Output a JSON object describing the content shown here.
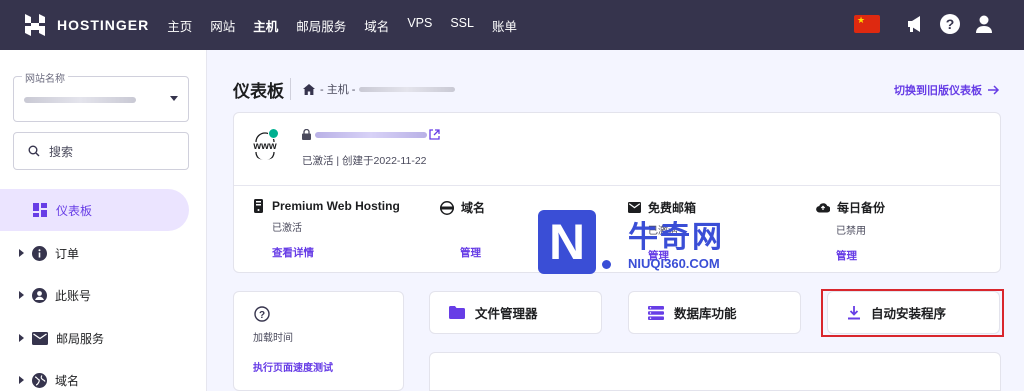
{
  "topbar": {
    "brand": "HOSTINGER",
    "nav": [
      "主页",
      "网站",
      "主机",
      "邮局服务",
      "域名",
      "VPS",
      "SSL",
      "账单"
    ],
    "active_nav": "主机"
  },
  "sidebar": {
    "site_select_label": "网站名称",
    "search_placeholder": "搜索",
    "items": [
      {
        "label": "仪表板",
        "icon": "dashboard-icon"
      },
      {
        "label": "订单",
        "icon": "info-icon"
      },
      {
        "label": "此账号",
        "icon": "account-icon"
      },
      {
        "label": "邮局服务",
        "icon": "mail-icon"
      },
      {
        "label": "域名",
        "icon": "globe-icon"
      }
    ]
  },
  "header": {
    "title": "仪表板",
    "breadcrumb": "- 主机 -",
    "switch_link": "切换到旧版仪表板"
  },
  "hosting": {
    "status": "已激活 | 创建于2022-11-22",
    "features": [
      {
        "title": "Premium Web Hosting",
        "sub": "已激活",
        "link": "查看详情",
        "icon": "server-icon"
      },
      {
        "title": "域名",
        "sub": "",
        "link": "管理",
        "icon": "www-icon"
      },
      {
        "title": "免费邮箱",
        "sub": "已激活",
        "link": "管理",
        "icon": "mail-icon"
      },
      {
        "title": "每日备份",
        "sub": "已禁用",
        "link": "管理",
        "icon": "cloud-upload-icon"
      }
    ]
  },
  "load_card": {
    "label": "加载时间",
    "link": "执行页面速度测试"
  },
  "tools": [
    {
      "label": "文件管理器",
      "icon": "folder-icon"
    },
    {
      "label": "数据库功能",
      "icon": "database-icon"
    },
    {
      "label": "自动安装程序",
      "icon": "download-icon"
    }
  ],
  "watermark": {
    "cn": "牛奇网",
    "en": "NIUQI360.COM"
  },
  "colors": {
    "topbar": "#36344d",
    "accent": "#673de6",
    "highlight": "#d9262c"
  }
}
